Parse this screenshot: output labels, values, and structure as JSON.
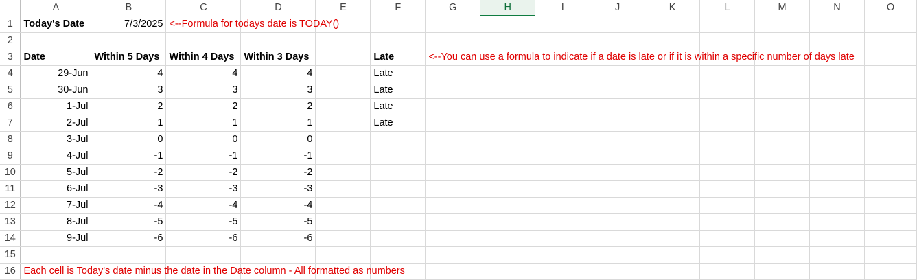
{
  "columns": [
    "A",
    "B",
    "C",
    "D",
    "E",
    "F",
    "G",
    "H",
    "I",
    "J",
    "K",
    "L",
    "M",
    "N",
    "O"
  ],
  "selected_column": "H",
  "rows": [
    "1",
    "2",
    "3",
    "4",
    "5",
    "6",
    "7",
    "8",
    "9",
    "10",
    "11",
    "12",
    "13",
    "14",
    "15",
    "16"
  ],
  "r1": {
    "a": "Today's Date",
    "b": "7/3/2025",
    "note": "<--Formula for todays date is TODAY()"
  },
  "r3": {
    "a": "Date",
    "b": "Within 5 Days",
    "c": "Within 4 Days",
    "d": "Within 3 Days",
    "f": "Late",
    "note": "<--You can use a formula to indicate if a date is late or if it is within a specific number of days late"
  },
  "data_rows": [
    {
      "date": "29-Jun",
      "b": "4",
      "c": "4",
      "d": "4",
      "f": "Late"
    },
    {
      "date": "30-Jun",
      "b": "3",
      "c": "3",
      "d": "3",
      "f": "Late"
    },
    {
      "date": "1-Jul",
      "b": "2",
      "c": "2",
      "d": "2",
      "f": "Late"
    },
    {
      "date": "2-Jul",
      "b": "1",
      "c": "1",
      "d": "1",
      "f": "Late"
    },
    {
      "date": "3-Jul",
      "b": "0",
      "c": "0",
      "d": "0",
      "f": ""
    },
    {
      "date": "4-Jul",
      "b": "-1",
      "c": "-1",
      "d": "-1",
      "f": ""
    },
    {
      "date": "5-Jul",
      "b": "-2",
      "c": "-2",
      "d": "-2",
      "f": ""
    },
    {
      "date": "6-Jul",
      "b": "-3",
      "c": "-3",
      "d": "-3",
      "f": ""
    },
    {
      "date": "7-Jul",
      "b": "-4",
      "c": "-4",
      "d": "-4",
      "f": ""
    },
    {
      "date": "8-Jul",
      "b": "-5",
      "c": "-5",
      "d": "-5",
      "f": ""
    },
    {
      "date": "9-Jul",
      "b": "-6",
      "c": "-6",
      "d": "-6",
      "f": ""
    }
  ],
  "r16": {
    "note": "Each cell is Today's date minus the date in the Date column - All formatted as numbers"
  },
  "colors": {
    "note_text": "#e00000",
    "selected_header": "#107c41",
    "gridline": "#d9d9d9"
  }
}
